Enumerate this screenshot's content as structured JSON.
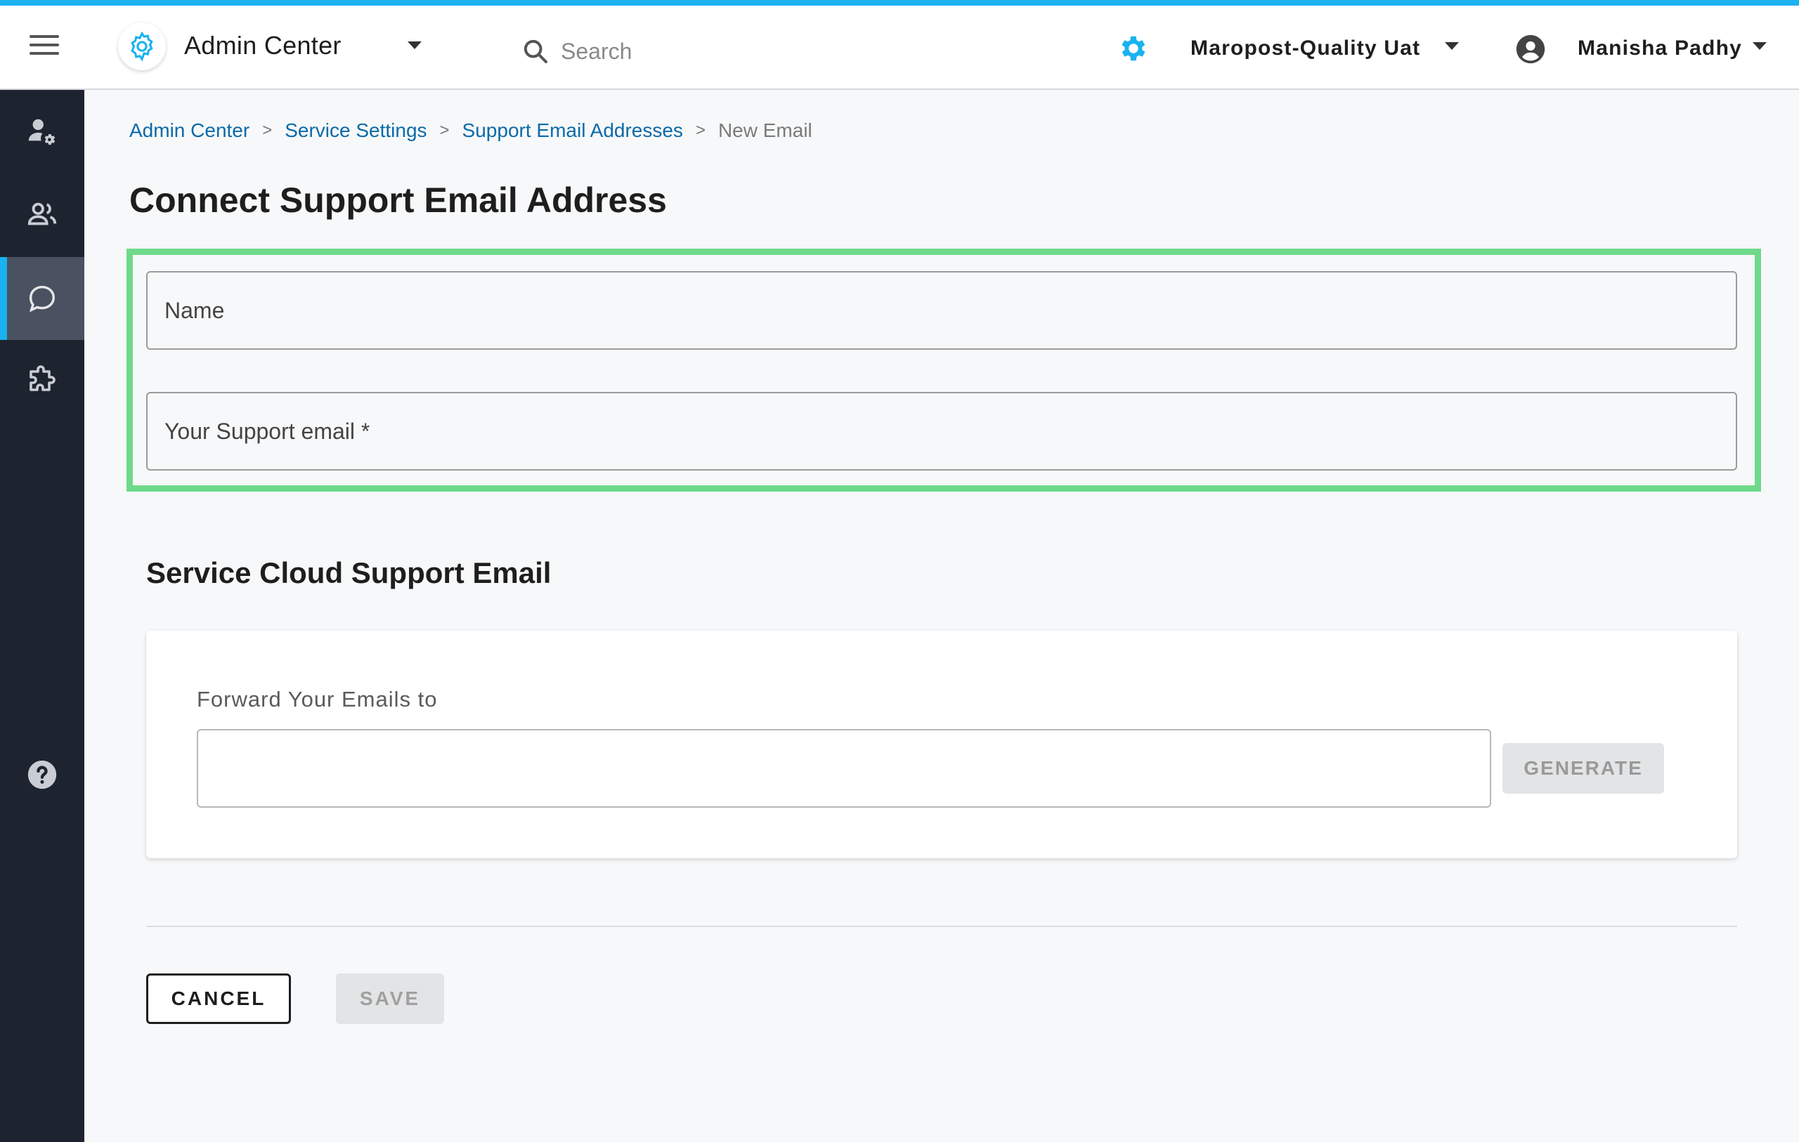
{
  "header": {
    "app_title": "Admin Center",
    "search_placeholder": "Search",
    "org_name": "Maropost-Quality Uat",
    "user_name": "Manisha Padhy"
  },
  "sidebar": {
    "items": [
      {
        "name": "user-settings-icon",
        "active": false
      },
      {
        "name": "users-icon",
        "active": false
      },
      {
        "name": "chat-icon",
        "active": true
      },
      {
        "name": "puzzle-icon",
        "active": false
      },
      {
        "name": "help-icon",
        "active": false
      }
    ]
  },
  "breadcrumb": {
    "items": [
      "Admin Center",
      "Service Settings",
      "Support Email Addresses"
    ],
    "current": "New Email",
    "separator": ">"
  },
  "page": {
    "title": "Connect Support Email Address"
  },
  "form": {
    "name_placeholder": "Name",
    "email_placeholder": "Your Support email *"
  },
  "service_cloud": {
    "section_title": "Service Cloud Support Email",
    "forward_label": "Forward Your Emails to",
    "forward_value": "",
    "generate_label": "GENERATE"
  },
  "actions": {
    "cancel_label": "CANCEL",
    "save_label": "SAVE"
  },
  "colors": {
    "accent": "#1ab2f0",
    "highlight": "#6fd98a",
    "sidebar_bg": "#1d2430",
    "link": "#0a6aa8"
  }
}
